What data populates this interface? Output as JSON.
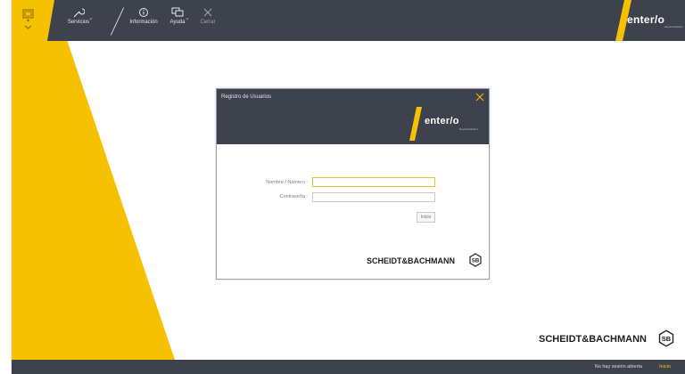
{
  "toolbar": {
    "servicios_label": "Servicios",
    "informacion_label": "Información",
    "ayuda_label": "Ayuda",
    "cerrar_label": "Cerrar"
  },
  "brand": {
    "logo_text": "enter/o",
    "tagline": "beyond barriers",
    "sb_logo_text": "SCHEIDT&BACHMANN",
    "sb_seal": "SB"
  },
  "dialog": {
    "title": "Registro de Usuarios",
    "username_label": "Nombre / Número :",
    "username_value": "",
    "password_label": "Contraseña :",
    "password_value": "",
    "login_button": "Inicio"
  },
  "statusbar": {
    "session_text": "No hay sesión abierta",
    "inicio_link": "Inicio"
  },
  "colors": {
    "accent": "#f5c000",
    "bar": "#3e424d"
  }
}
